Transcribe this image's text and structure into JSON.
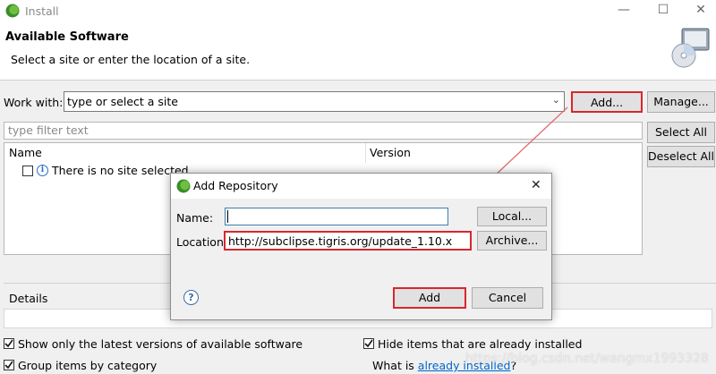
{
  "window": {
    "title": "Install",
    "minimize": "—",
    "maximize": "☐",
    "close": "✕"
  },
  "header": {
    "title": "Available Software",
    "description": "Select a site or enter the location of a site."
  },
  "work_with": {
    "label": "Work with:",
    "value": "type or select a site",
    "add": "Add...",
    "manage": "Manage..."
  },
  "filter": {
    "placeholder": "type filter text"
  },
  "buttons": {
    "select_all": "Select All",
    "deselect_all": "Deselect All"
  },
  "table": {
    "columns": [
      "Name",
      "Version"
    ],
    "rows": [
      {
        "name": "There is no site selected."
      }
    ]
  },
  "details": {
    "label": "Details"
  },
  "options": {
    "show_latest": "Show only the latest versions of available software",
    "hide_installed": "Hide items that are already installed",
    "group_by_category": "Group items by category",
    "what_is": "What is ",
    "already_installed": "already installed",
    "question": "?"
  },
  "dialog": {
    "title": "Add Repository",
    "name_label": "Name:",
    "name_value": "",
    "location_label": "Location:",
    "location_value": "http://subclipse.tigris.org/update_1.10.x",
    "local_button": "Local...",
    "archive_button": "Archive...",
    "help": "?",
    "add_button": "Add",
    "cancel_button": "Cancel",
    "close": "✕"
  },
  "watermark": "https://blog.csdn.net/wangmx1993328",
  "colors": {
    "highlight": "#d9262c",
    "link": "#0066cc"
  }
}
